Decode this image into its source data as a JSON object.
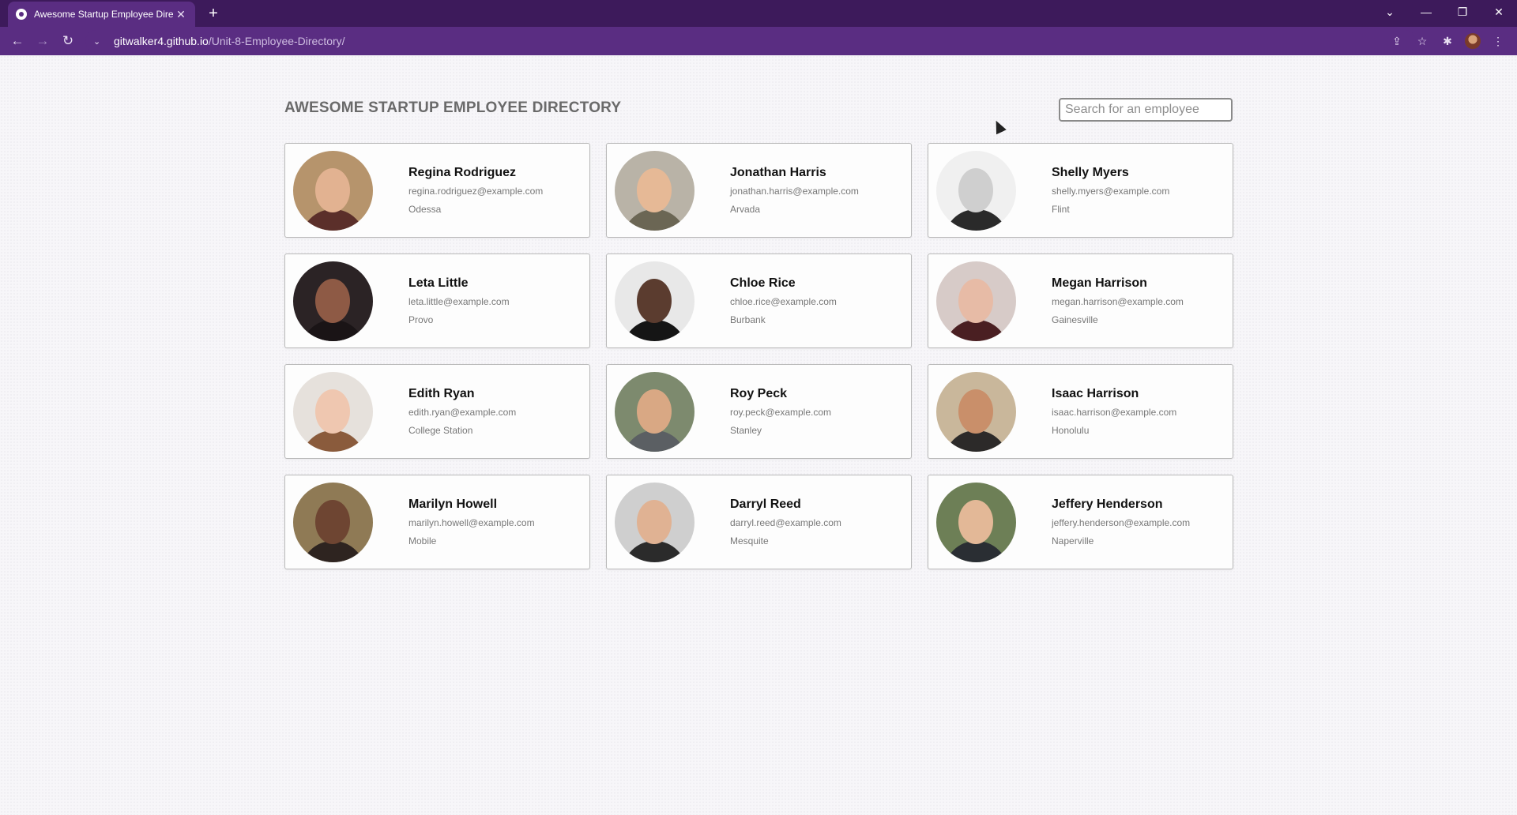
{
  "browser": {
    "tab_title": "Awesome Startup Employee Dire",
    "tab_close": "✕",
    "new_tab": "+",
    "url_host": "gitwalker4.github.io",
    "url_path": "/Unit-8-Employee-Directory/",
    "icons": {
      "back": "back-arrow-icon",
      "forward": "forward-arrow-icon",
      "reload": "reload-icon",
      "share": "share-icon",
      "bookmark": "star-icon",
      "extensions": "puzzle-icon",
      "menu": "kebab-menu-icon"
    },
    "colors": {
      "frame": "#3d1a5b",
      "toolbar": "#5a2d82"
    }
  },
  "page": {
    "title": "AWESOME STARTUP EMPLOYEE DIRECTORY",
    "search_placeholder": "Search for an employee"
  },
  "employees": [
    {
      "name": "Regina Rodriguez",
      "email": "regina.rodriguez@example.com",
      "city": "Odessa",
      "bg": "#b6946c",
      "skin": "#e2b291",
      "shirt": "#5b2f2a"
    },
    {
      "name": "Jonathan Harris",
      "email": "jonathan.harris@example.com",
      "city": "Arvada",
      "bg": "#b9b3a7",
      "skin": "#e6b996",
      "shirt": "#6b6654"
    },
    {
      "name": "Shelly Myers",
      "email": "shelly.myers@example.com",
      "city": "Flint",
      "bg": "#f0f0f0",
      "skin": "#cfcfcf",
      "shirt": "#2a2a2a"
    },
    {
      "name": "Leta Little",
      "email": "leta.little@example.com",
      "city": "Provo",
      "bg": "#2b2325",
      "skin": "#8e5a45",
      "shirt": "#1a1416"
    },
    {
      "name": "Chloe Rice",
      "email": "chloe.rice@example.com",
      "city": "Burbank",
      "bg": "#e8e8e8",
      "skin": "#5b3c2f",
      "shirt": "#151515"
    },
    {
      "name": "Megan Harrison",
      "email": "megan.harrison@example.com",
      "city": "Gainesville",
      "bg": "#d7cbc8",
      "skin": "#e7bba6",
      "shirt": "#4a1f22"
    },
    {
      "name": "Edith Ryan",
      "email": "edith.ryan@example.com",
      "city": "College Station",
      "bg": "#e6e1dc",
      "skin": "#efc7b0",
      "shirt": "#8a5b3c"
    },
    {
      "name": "Roy Peck",
      "email": "roy.peck@example.com",
      "city": "Stanley",
      "bg": "#7d8a6e",
      "skin": "#d9a884",
      "shirt": "#5b5f63"
    },
    {
      "name": "Isaac Harrison",
      "email": "isaac.harrison@example.com",
      "city": "Honolulu",
      "bg": "#c9b79b",
      "skin": "#c98f6a",
      "shirt": "#2c2a29"
    },
    {
      "name": "Marilyn Howell",
      "email": "marilyn.howell@example.com",
      "city": "Mobile",
      "bg": "#8f7a55",
      "skin": "#6e4532",
      "shirt": "#2e2420"
    },
    {
      "name": "Darryl Reed",
      "email": "darryl.reed@example.com",
      "city": "Mesquite",
      "bg": "#cfcfcf",
      "skin": "#e0b293",
      "shirt": "#2b2b2b"
    },
    {
      "name": "Jeffery Henderson",
      "email": "jeffery.henderson@example.com",
      "city": "Naperville",
      "bg": "#6d7f56",
      "skin": "#e3b897",
      "shirt": "#2a2e33"
    }
  ]
}
